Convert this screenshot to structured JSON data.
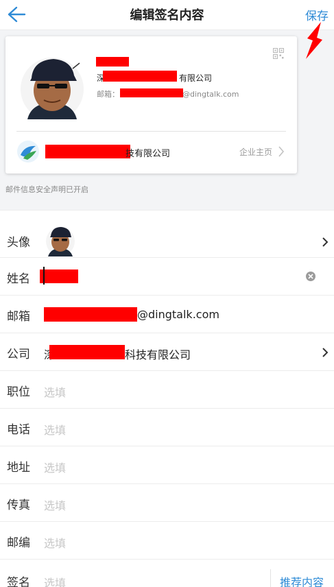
{
  "header": {
    "title": "编辑签名内容",
    "save_label": "保存"
  },
  "card": {
    "company_line": "有限公司",
    "company_line_prefix": "深",
    "email_label": "邮箱：",
    "email_suffix": "@dingtalk.com",
    "company_name_suffix": "技有限公司",
    "homepage_label": "企业主页"
  },
  "notice": "邮件信息安全声明已开启",
  "form": {
    "avatar_label": "头像",
    "name_label": "姓名",
    "email_label": "邮箱",
    "email_suffix": "@dingtalk.com",
    "company_label": "公司",
    "company_prefix": "深",
    "company_suffix": "科技有限公司",
    "position_label": "职位",
    "phone_label": "电话",
    "address_label": "地址",
    "fax_label": "传真",
    "zip_label": "邮编",
    "signature_label": "签名",
    "placeholder": "选填",
    "recommend_label": "推荐内容"
  },
  "colors": {
    "accent": "#2f8bd6",
    "redaction": "#ff0000",
    "annotation_arrow": "#ff0000"
  },
  "icons": [
    "back-arrow-icon",
    "qr-code-icon",
    "chevron-right-icon",
    "clear-icon",
    "company-logo-icon",
    "avatar-image"
  ]
}
